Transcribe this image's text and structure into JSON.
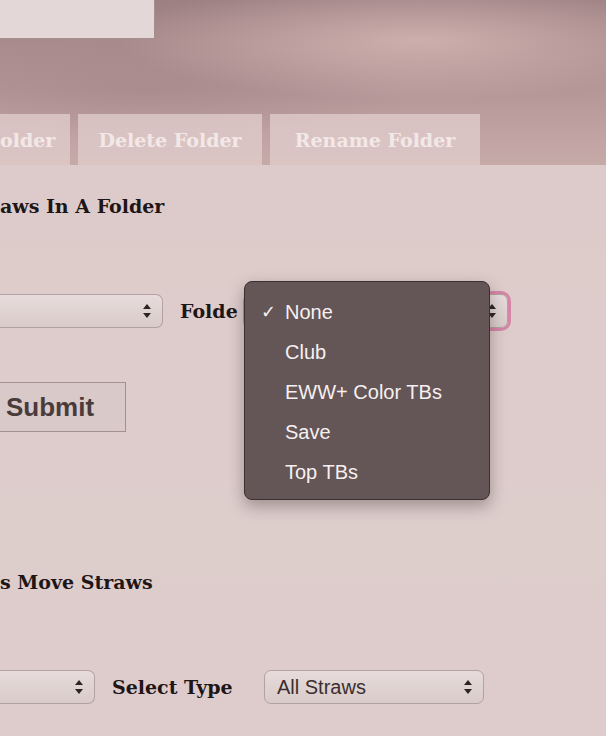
{
  "tabs": [
    {
      "label": "older",
      "selected": false
    },
    {
      "label": "Delete Folder",
      "selected": false
    },
    {
      "label": "Rename Folder",
      "selected": false
    }
  ],
  "folder_section": {
    "heading": "aws In A Folder",
    "straw_select": {
      "value": ""
    },
    "folder_label": "Folde",
    "folder_select": {
      "focused": true,
      "open": true
    },
    "check_mark": "✓",
    "menu": [
      {
        "label": "None",
        "selected": true
      },
      {
        "label": "Club",
        "selected": false
      },
      {
        "label": "EWW+ Color TBs",
        "selected": false
      },
      {
        "label": "Save",
        "selected": false
      },
      {
        "label": "Top TBs",
        "selected": false
      }
    ],
    "submit": "Submit"
  },
  "move_section": {
    "heading": "s Move Straws",
    "straw_select": {
      "value": ""
    },
    "type_label": "Select Type",
    "type_select": {
      "value": "All Straws"
    }
  }
}
